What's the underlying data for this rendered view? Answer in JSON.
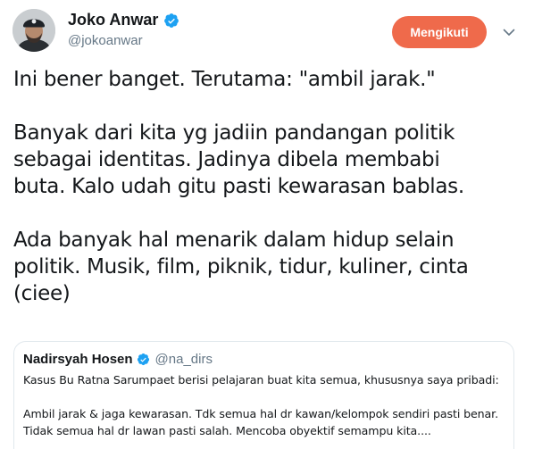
{
  "author": {
    "display_name": "Joko Anwar",
    "handle": "@jokoanwar",
    "verified": true,
    "avatar_icon": "profile-photo"
  },
  "follow_button": {
    "label": "Mengikuti",
    "color": "#ef6a4b"
  },
  "more_menu_icon": "chevron-down-icon",
  "tweet": {
    "paragraphs": [
      "Ini bener banget. Terutama: \"ambil jarak.\"",
      "Banyak dari kita yg jadiin pandangan politik\nsebagai identitas. Jadinya dibela membabi\nbuta. Kalo udah gitu pasti kewarasan bablas.",
      "Ada banyak hal menarik dalam hidup selain\npolitik. Musik, film, piknik, tidur, kuliner, cinta\n(ciee)"
    ]
  },
  "quoted_tweet": {
    "display_name": "Nadirsyah Hosen",
    "handle": "@na_dirs",
    "verified": true,
    "lines": [
      "Kasus Bu Ratna Sarumpaet berisi pelajaran buat kita semua, khususnya saya pribadi:",
      "",
      "Ambil jarak & jaga kewarasan. Tdk semua hal dr kawan/kelompok sendiri pasti benar.",
      "Tidak semua hal dr lawan pasti salah. Mencoba obyektif semampu kita...."
    ]
  },
  "colors": {
    "verified_blue": "#1da1f2",
    "secondary_text": "#657786",
    "border": "#e1e8ed"
  }
}
